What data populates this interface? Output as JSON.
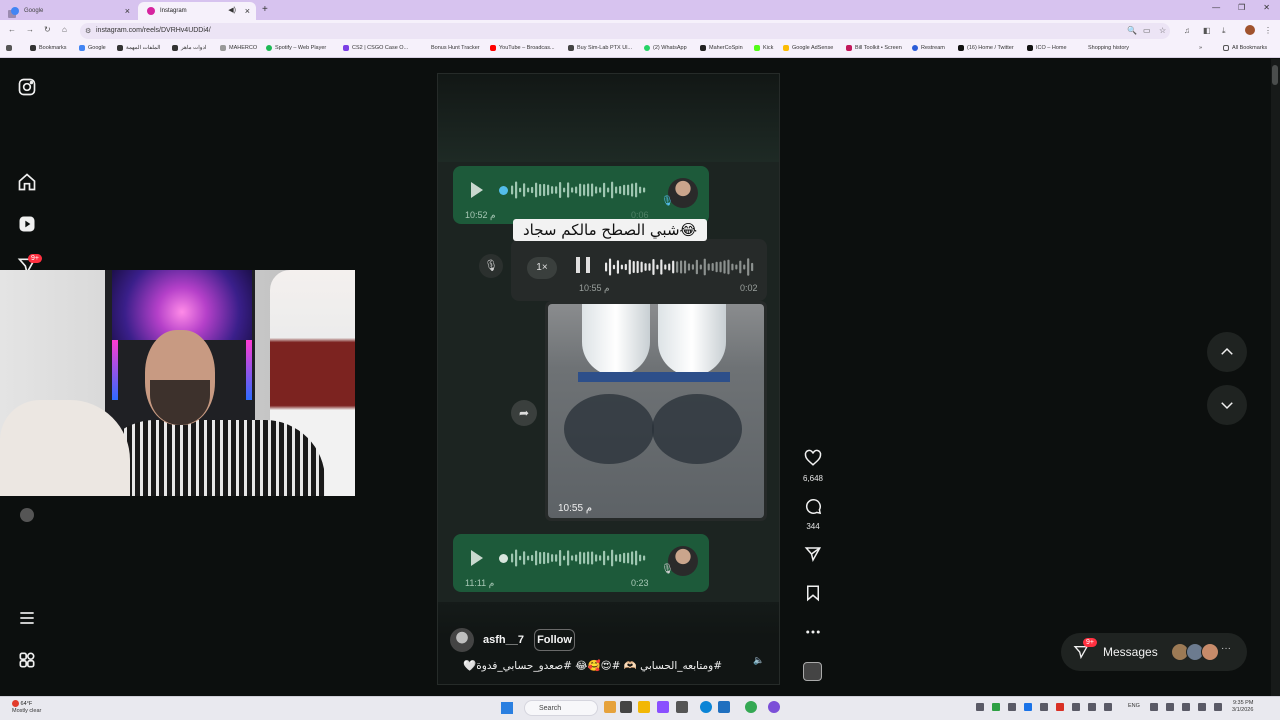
{
  "browser": {
    "tabs": [
      {
        "label": "Google",
        "active": false
      },
      {
        "label": "Instagram",
        "active": true
      }
    ],
    "url": "instagram.com/reels/DVRHv4UDDi4/",
    "bookmarks": [
      "Bookmarks",
      "Google",
      "الملفات المهمة",
      "ادوات ماهر",
      "MAHERCO",
      "Spotify – Web Player",
      "CS2 | CSGO Case O...",
      "Bonus Hunt Tracker",
      "YouTube – Broadcas...",
      "Buy Sim-Lab PTX Ul...",
      "(2) WhatsApp",
      "MaherCoSpin",
      "Kick",
      "Google AdSense",
      "Bill Toolkit • Screen",
      "Restream",
      "(16) Home / Twitter",
      "ICO – Home",
      "Shopping history"
    ],
    "all_bookmarks": "All Bookmarks"
  },
  "sidebar": {
    "notification_badge": "9+"
  },
  "reel": {
    "voice1": {
      "time": "10:52 م",
      "duration": "0:06"
    },
    "overlay_caption": "شبي الصطح مالكم سجاد😂",
    "voice2": {
      "speed": "1×",
      "time": "10:55 م",
      "duration": "0:02"
    },
    "photo_time": "10:55 م",
    "voice3": {
      "time": "11:11 م",
      "duration": "0:23"
    },
    "username": "asfh__7",
    "follow_label": "Follow",
    "caption": "#ومتابعه_الحسابي 🫶🏻 #😍🥰😂 #صعدو_حسابي_فدوة🤍"
  },
  "actions": {
    "likes": "6,648",
    "comments": "344"
  },
  "messages": {
    "label": "Messages",
    "badge": "9+"
  },
  "taskbar": {
    "weather_temp": "64°F",
    "weather_desc": "Mostly clear",
    "search_placeholder": "Search",
    "tray_lang": "ENG",
    "time": "9:35 PM",
    "date": "3/1/2026"
  },
  "colors": {
    "accent_green": "#1d5a3a",
    "badge_red": "#ff3040",
    "page_bg": "#0c0f0e"
  }
}
